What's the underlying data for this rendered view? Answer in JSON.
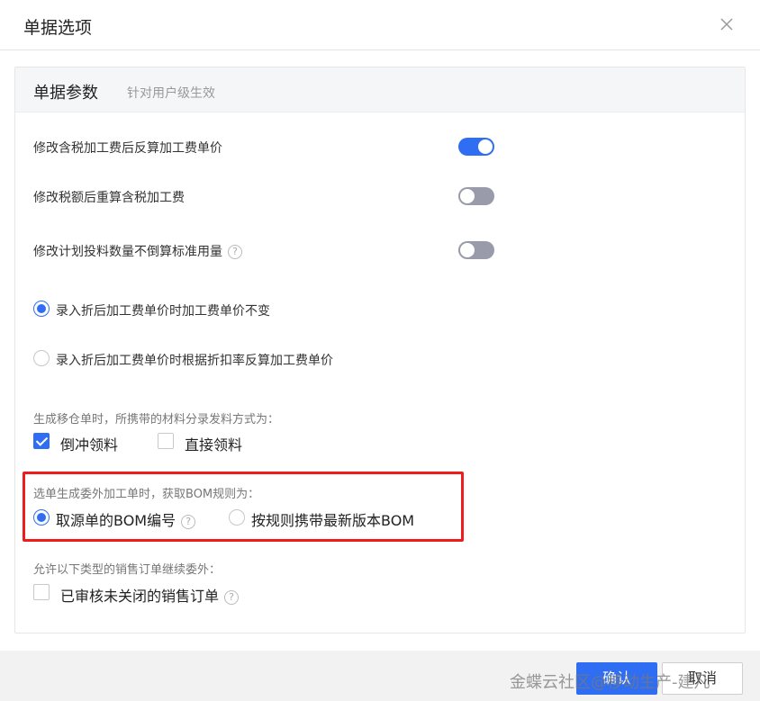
{
  "dialog": {
    "title": "单据选项"
  },
  "panel": {
    "title": "单据参数",
    "subtitle": "针对用户级生效"
  },
  "switches": [
    {
      "label": "修改含税加工费后反算加工费单价",
      "on": true
    },
    {
      "label": "修改税额后重算含税加工费",
      "on": false
    },
    {
      "label": "修改计划投料数量不倒算标准用量",
      "on": false
    }
  ],
  "price_radios": [
    {
      "label": "录入折后加工费单价时加工费单价不变",
      "selected": true
    },
    {
      "label": "录入折后加工费单价时根据折扣率反算加工费单价",
      "selected": false
    }
  ],
  "transfer": {
    "label": "生成移仓单时，所携带的材料分录发料方式为：",
    "options": [
      {
        "label": "倒冲领料",
        "checked": true
      },
      {
        "label": "直接领料",
        "checked": false
      }
    ]
  },
  "bom_rule": {
    "label": "选单生成委外加工单时，获取BOM规则为：",
    "options": [
      {
        "label": "取源单的BOM编号",
        "selected": true
      },
      {
        "label": "按规则携带最新版本BOM",
        "selected": false
      }
    ]
  },
  "sales_order": {
    "label": "允许以下类型的销售订单继续委外：",
    "option": "已审核未关闭的销售订单",
    "checked": false
  },
  "help_glyph": "?",
  "buttons": {
    "ok": "确认",
    "cancel": "取消"
  },
  "watermark": "金蝶云社区@移动生产-建凡",
  "colors": {
    "accent": "#2f6ef3",
    "highlight": "#ee1c1c"
  }
}
